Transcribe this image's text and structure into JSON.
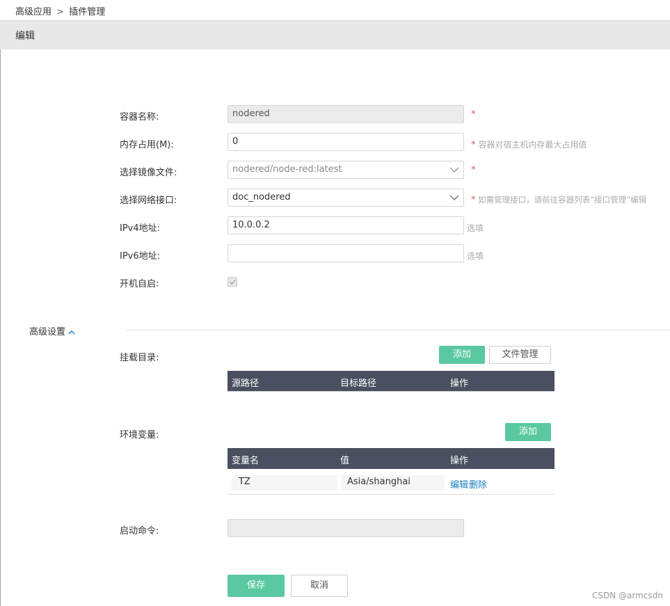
{
  "breadcrumb": {
    "parent": "高级应用",
    "separator": ">",
    "current": "插件管理"
  },
  "page_title": "编辑",
  "form": {
    "container_name": {
      "label": "容器名称:",
      "value": "nodered",
      "required": "*"
    },
    "memory": {
      "label": "内存占用(M):",
      "value": "0",
      "required": "*",
      "hint": "容器对宿主机内存最大占用值"
    },
    "image_file": {
      "label": "选择镜像文件:",
      "value": "nodered/node-red:latest",
      "required": "*"
    },
    "network": {
      "label": "选择网络接口:",
      "value": "doc_nodered",
      "required": "*",
      "hint": "如需管理接口，请前往容器列表“接口管理”编辑"
    },
    "ipv4": {
      "label": "IPv4地址:",
      "value": "10.0.0.2",
      "hint": "选填"
    },
    "ipv6": {
      "label": "IPv6地址:",
      "value": "",
      "hint": "选填"
    },
    "autostart": {
      "label": "开机自启:",
      "checked": true
    }
  },
  "advanced": {
    "label": "高级设置",
    "mount": {
      "label": "挂载目录:",
      "add_button": "添加",
      "file_button": "文件管理",
      "columns": [
        "源路径",
        "目标路径",
        "操作"
      ]
    },
    "env": {
      "label": "环境变量:",
      "add_button": "添加",
      "columns": [
        "变量名",
        "值",
        "操作"
      ],
      "rows": [
        {
          "name": "TZ",
          "value": "Asia/shanghai",
          "edit": "编辑",
          "delete": "删除"
        }
      ]
    },
    "command": {
      "label": "启动命令:",
      "value": ""
    }
  },
  "actions": {
    "save": "保存",
    "cancel": "取消"
  },
  "watermark": "CSDN @armcsdn",
  "colors": {
    "accent_green": "#5ac8a0",
    "table_header": "#4a5060",
    "link": "#1a7ec2",
    "required": "#e55555"
  }
}
